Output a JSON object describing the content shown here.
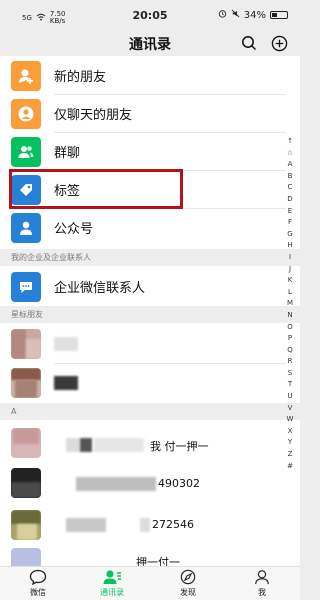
{
  "status_bar": {
    "signal": "5G",
    "speed": "7.50",
    "speed_unit": "KB/s",
    "time": "20:05",
    "battery": "34%"
  },
  "header": {
    "title": "通讯录",
    "search_icon": "search-icon",
    "add_icon": "plus-circle-icon"
  },
  "top_items": [
    {
      "label": "新的朋友",
      "icon": "add-friend-icon",
      "color": "#fa9d3b"
    },
    {
      "label": "仅聊天的朋友",
      "icon": "chat-only-friend-icon",
      "color": "#fa9d3b"
    },
    {
      "label": "群聊",
      "icon": "group-chat-icon",
      "color": "#07c160"
    },
    {
      "label": "标签",
      "icon": "tag-icon",
      "color": "#2782d7"
    },
    {
      "label": "公众号",
      "icon": "official-account-icon",
      "color": "#2782d7"
    }
  ],
  "sections": {
    "enterprise": "我的企业及企业联系人",
    "enterprise_item": "企业微信联系人",
    "starred": "星标朋友",
    "a": "A"
  },
  "contacts": [
    {
      "name": ""
    },
    {
      "name": ""
    },
    {
      "name": "我 付一押一"
    },
    {
      "name": "490302"
    },
    {
      "name": "272546"
    },
    {
      "name": "押一付一"
    }
  ],
  "alpha_index": [
    "↑",
    "☆",
    "A",
    "B",
    "C",
    "D",
    "E",
    "F",
    "G",
    "H",
    "I",
    "J",
    "K",
    "L",
    "M",
    "N",
    "O",
    "P",
    "Q",
    "R",
    "S",
    "T",
    "U",
    "V",
    "W",
    "X",
    "Y",
    "Z",
    "#"
  ],
  "tabbar": {
    "tabs": [
      {
        "label": "微信",
        "icon": "chat-bubble-icon"
      },
      {
        "label": "通讯录",
        "icon": "contacts-icon"
      },
      {
        "label": "发现",
        "icon": "compass-icon"
      },
      {
        "label": "我",
        "icon": "person-icon"
      }
    ],
    "active_color": "#07c160"
  }
}
